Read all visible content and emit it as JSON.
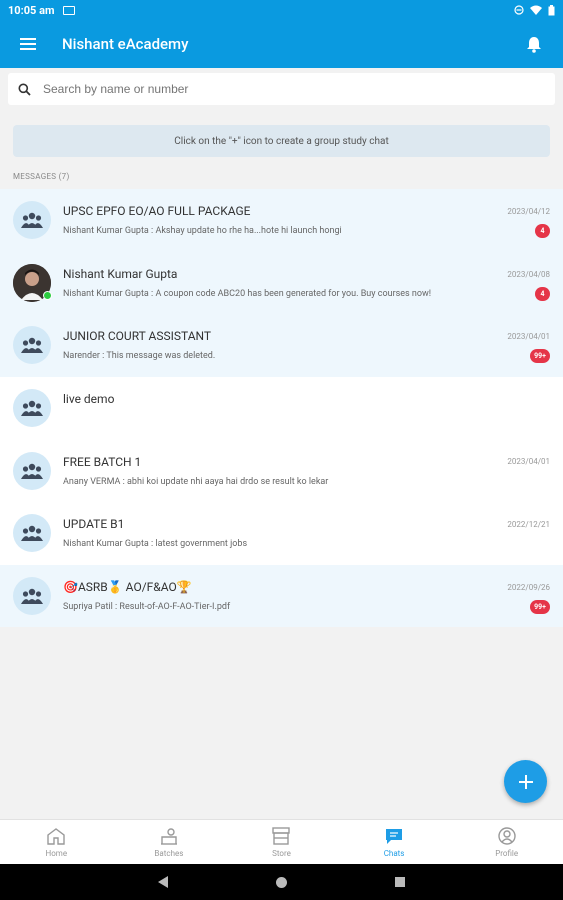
{
  "status_bar": {
    "time": "10:05 am"
  },
  "app_bar": {
    "title": "Nishant eAcademy"
  },
  "search": {
    "placeholder": "Search by name or number"
  },
  "hint": "Click on the \"+\" icon to create a group study chat",
  "messages_header": "MESSAGES (7)",
  "chats": [
    {
      "title": "UPSC EPFO EO/AO FULL PACKAGE",
      "preview": "Nishant Kumar Gupta :  Akshay update ho rhe ha...hote hi launch hongi",
      "date": "2023/04/12",
      "badge": "4",
      "avatar": "group-icon"
    },
    {
      "title": "Nishant Kumar Gupta",
      "preview": "Nishant Kumar Gupta :  A coupon code ABC20 has been generated for you. Buy courses now!",
      "date": "2023/04/08",
      "badge": "4",
      "avatar": "user-photo"
    },
    {
      "title": "JUNIOR COURT ASSISTANT",
      "preview": "Narender :  This message was deleted.",
      "date": "2023/04/01",
      "badge": "99+",
      "avatar": "group-icon"
    },
    {
      "title": "live demo",
      "preview": "",
      "date": "",
      "badge": "",
      "avatar": "group-icon"
    },
    {
      "title": "FREE BATCH 1",
      "preview": "Anany  VERMA :  abhi koi update nhi aaya hai drdo se result ko lekar",
      "date": "2023/04/01",
      "badge": "",
      "avatar": "group-icon"
    },
    {
      "title": "UPDATE B1",
      "preview": "Nishant Kumar Gupta :  latest government jobs",
      "date": "2022/12/21",
      "badge": "",
      "avatar": "group-icon"
    },
    {
      "title": "🎯ASRB🥇 AO/F&AO🏆",
      "preview": "Supriya Patil :  Result-of-AO-F-AO-Tier-I.pdf",
      "date": "2022/09/26",
      "badge": "99+",
      "avatar": "group-icon"
    }
  ],
  "bottom_nav": {
    "home": "Home",
    "batches": "Batches",
    "store": "Store",
    "chats": "Chats",
    "profile": "Profile",
    "active": "chats"
  },
  "colors": {
    "primary": "#0a9ae0",
    "badge": "#e53548",
    "online": "#2ecc40",
    "unread_bg": "#eef7fd"
  }
}
